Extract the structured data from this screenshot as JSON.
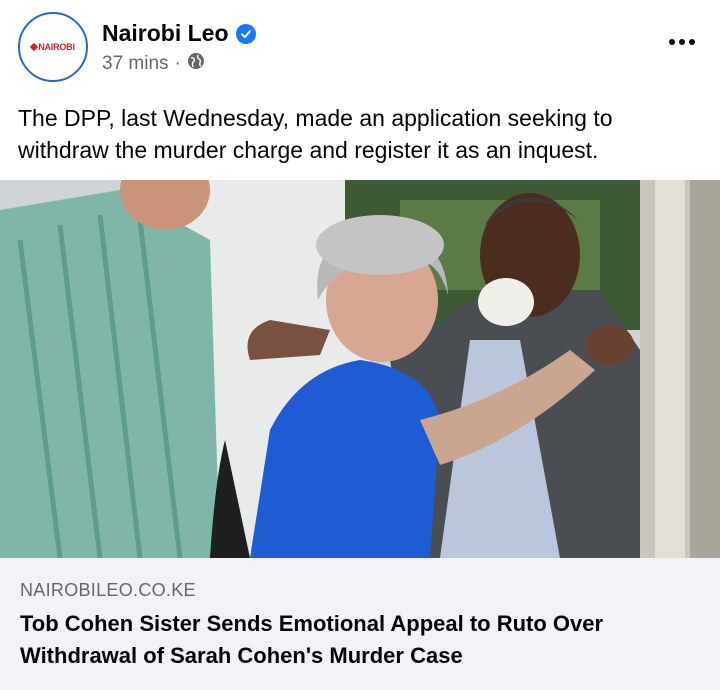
{
  "post": {
    "page_name": "Nairobi Leo",
    "avatar_text": "NAIROBI",
    "timestamp": "37 mins",
    "separator": "·",
    "audience_icon": "globe-icon",
    "verified_icon": "verified-badge-icon",
    "menu_icon": "more-options-icon",
    "caption": "The DPP, last Wednesday, made an application seeking to withdraw the murder charge and register it as an inquest."
  },
  "link_preview": {
    "domain": "NAIROBILEO.CO.KE",
    "title": "Tob Cohen Sister Sends Emotional Appeal to Ruto Over Withdrawal of Sarah Cohen's Murder Case"
  },
  "colors": {
    "verified": "#1877f2",
    "avatar_ring": "#2b66c8",
    "brand_red": "#d6202a",
    "meta_gray": "#65676b",
    "card_bg": "#f0f2f5"
  }
}
